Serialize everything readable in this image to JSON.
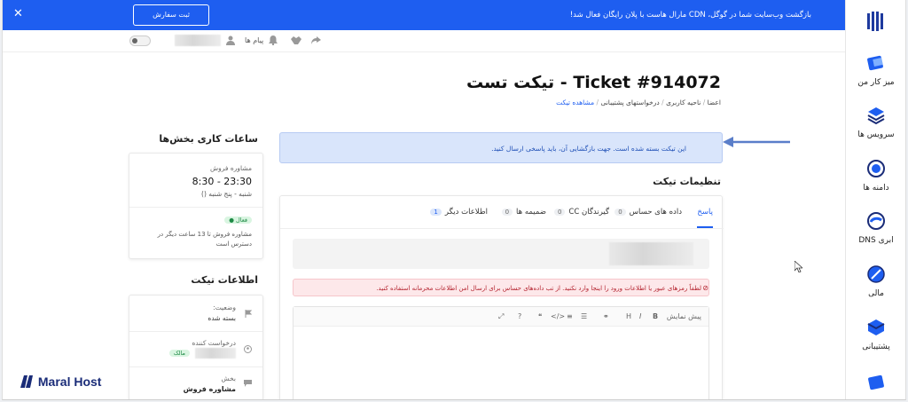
{
  "banner": {
    "message": "بازگشت وب‌سایت شما در گوگل، CDN مارال هاست با پلان رایگان فعال شد!",
    "button": "ثبت سفارش"
  },
  "topbar": {
    "messages_label": "پیام ها"
  },
  "sidebar": {
    "items": [
      {
        "label": "میز کار من",
        "icon": "desk-icon"
      },
      {
        "label": "سرویس ها",
        "icon": "layers-icon"
      },
      {
        "label": "دامنه ها",
        "icon": "globe-icon"
      },
      {
        "label": "DNS ابری",
        "icon": "cloud-dns-icon"
      },
      {
        "label": "مالی",
        "icon": "finance-icon"
      },
      {
        "label": "پشتیبانی",
        "icon": "support-icon"
      }
    ]
  },
  "ticket": {
    "title": "Ticket #914072 - تیکت تست"
  },
  "breadcrumb": {
    "items": [
      "اعضا",
      "ناحیه کاربری",
      "درخواستهای پشتیبانی"
    ],
    "current": "مشاهده تیکت",
    "sep": "/"
  },
  "alert": {
    "text": "این تیکت بسته شده است. جهت بازگشایی آن، باید پاسخی ارسال کنید."
  },
  "settings": {
    "heading": "تنظیمات تیکت"
  },
  "tabs": [
    {
      "label": "پاسخ",
      "count": ""
    },
    {
      "label": "داده های حساس",
      "count": "0"
    },
    {
      "label": "گیرندگان CC",
      "count": "0"
    },
    {
      "label": "ضمیمه ها",
      "count": "0"
    },
    {
      "label": "اطلاعات دیگر",
      "count": "1"
    }
  ],
  "warning": {
    "text": "لطفاً رمزهای عبور یا اطلاعات ورود را اینجا وارد نکنید. از تب داده‌های حساس برای ارسال امن اطلاعات محرمانه استفاده کنید."
  },
  "editor": {
    "preview_label": "پیش نمایش"
  },
  "hours": {
    "heading": "ساعات کاری بخش‌ها",
    "dept": "مشاوره فروش",
    "time": "8:30 - 23:30",
    "days": "شنبه - پنج شنبه ()",
    "status": "فعال",
    "note": "مشاوره فروش تا 13 ساعت دیگر در دسترس است"
  },
  "info": {
    "heading": "اطلاعات تیکت",
    "status_label": "وضعیت:",
    "status_value": "بسته شده",
    "requester_label": "درخواست کننده",
    "requester_badge": "مالک",
    "dept_label": "بخش",
    "dept_value": "مشاوره فروش"
  },
  "brand": {
    "name": "Maral Host"
  },
  "colors": {
    "primary": "#1e5ef0",
    "alert_bg": "#d9e5fb",
    "warn_bg": "#fde8ea"
  }
}
